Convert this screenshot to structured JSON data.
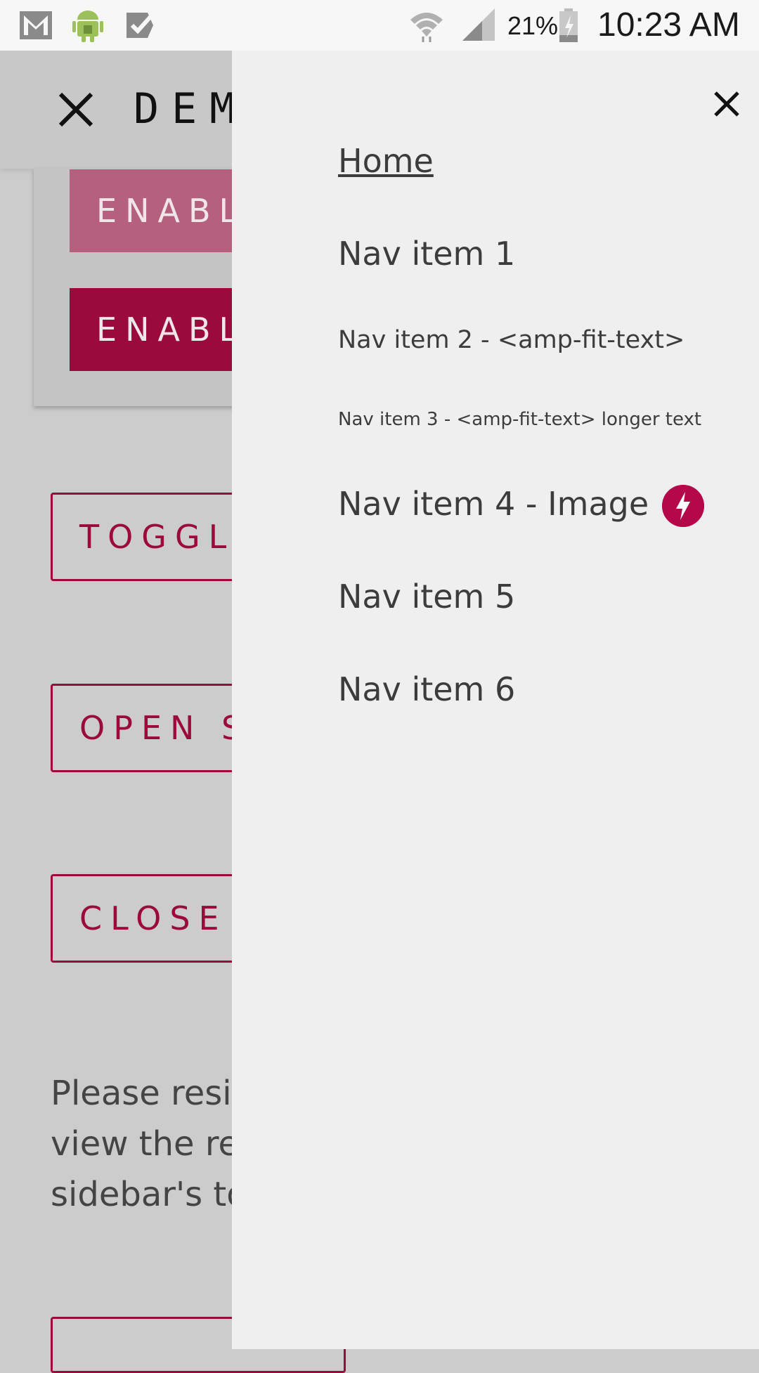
{
  "status_bar": {
    "battery": "21%",
    "time": "10:23 AM",
    "icons": [
      "gmail-icon",
      "android-icon",
      "task-check-icon",
      "wifi-icon",
      "signal-icon",
      "battery-icon"
    ]
  },
  "header": {
    "title": "DEM"
  },
  "page": {
    "buttons_filled": [
      "ENABL",
      "ENABL"
    ],
    "buttons_outline": [
      "TOGGL",
      "OPEN S",
      "CLOSE"
    ],
    "paragraph_lines": [
      "Please resi",
      "view the re",
      "sidebar's to"
    ]
  },
  "sidebar": {
    "nav": [
      {
        "label": "Home"
      },
      {
        "label": "Nav item 1"
      },
      {
        "label": "Nav item 2 - <amp-fit-text>"
      },
      {
        "label": "Nav item 3 - <amp-fit-text> longer text"
      },
      {
        "label": "Nav item 4 - Image"
      },
      {
        "label": "Nav item 5"
      },
      {
        "label": "Nav item 6"
      }
    ]
  },
  "colors": {
    "accent": "#9b0a3c",
    "accent_light": "#b5607e",
    "sidebar_bg": "#efefef",
    "scrim": "#cccccc"
  }
}
